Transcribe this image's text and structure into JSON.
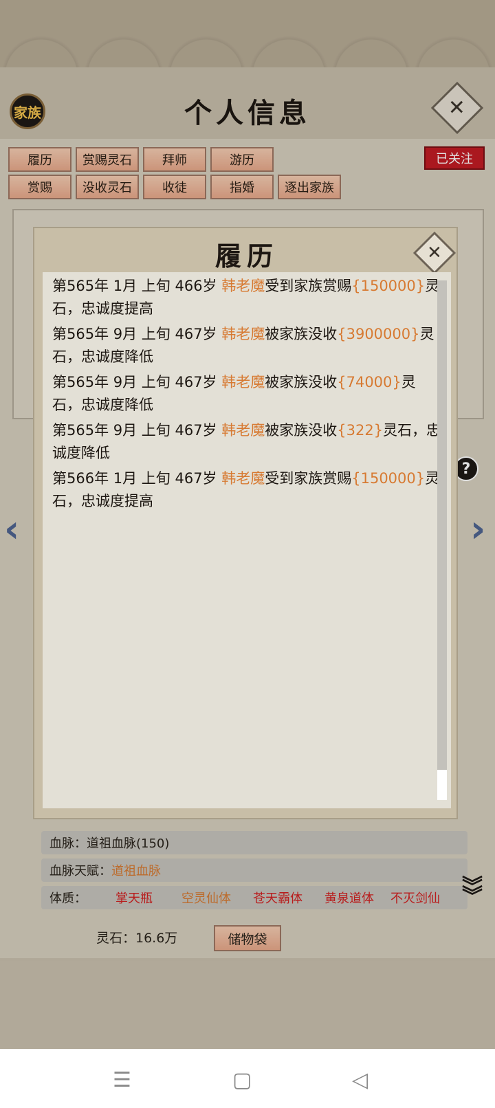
{
  "header": {
    "family_badge": "家族",
    "title": "个人信息"
  },
  "actions": {
    "row1": [
      "履历",
      "赏赐灵石",
      "拜师",
      "游历"
    ],
    "row2": [
      "赏赐",
      "没收灵石",
      "收徒",
      "指婚",
      "逐出家族"
    ],
    "follow": "已关注"
  },
  "attributes": {
    "bloodline": "血脉：道祖血脉(150)",
    "bloodline_talent_label": "血脉天赋：",
    "bloodline_talent_value": "道祖血脉",
    "physique_label": "体质：",
    "physiques": [
      {
        "name": "掌天瓶",
        "color": "#d22222"
      },
      {
        "name": "空灵仙体",
        "color": "#d77a32"
      },
      {
        "name": "苍天霸体",
        "color": "#d22222"
      },
      {
        "name": "黄泉道体",
        "color": "#d22222"
      },
      {
        "name": "不灭剑仙",
        "color": "#d22222"
      }
    ]
  },
  "footer": {
    "spirit_stones": "灵石：16.6万",
    "bag_button": "储物袋"
  },
  "dialog": {
    "title": "履历",
    "entries": [
      {
        "prefix": "第565年  1月  上旬   466岁  ",
        "name": "韩老魔",
        "action": "受到家族赏赐",
        "amount": "{150000}",
        "suffix": "灵石，忠诚度提高"
      },
      {
        "prefix": "第565年  9月  上旬   467岁   ",
        "name": "韩老魔",
        "action": "被家族没收",
        "amount": "{3900000}",
        "suffix": "灵石，忠诚度降低"
      },
      {
        "prefix": "第565年 9月 上旬 467岁 ",
        "name": "韩老魔",
        "action": "被家族没收",
        "amount": "{74000}",
        "suffix": "灵石，忠诚度降低"
      },
      {
        "prefix": "第565年  9月 上旬  467岁  ",
        "name": "韩老魔",
        "action": "被家族没收",
        "amount": "{322}",
        "suffix": "灵石，忠诚度降低"
      },
      {
        "prefix": "第566年  1月  上旬   467岁  ",
        "name": "韩老魔",
        "action": "受到家族赏赐",
        "amount": "{150000}",
        "suffix": "灵石，忠诚度提高"
      }
    ]
  },
  "nav": {
    "menu_icon": "menu-icon",
    "home_icon": "home-icon",
    "back_icon": "back-icon"
  }
}
